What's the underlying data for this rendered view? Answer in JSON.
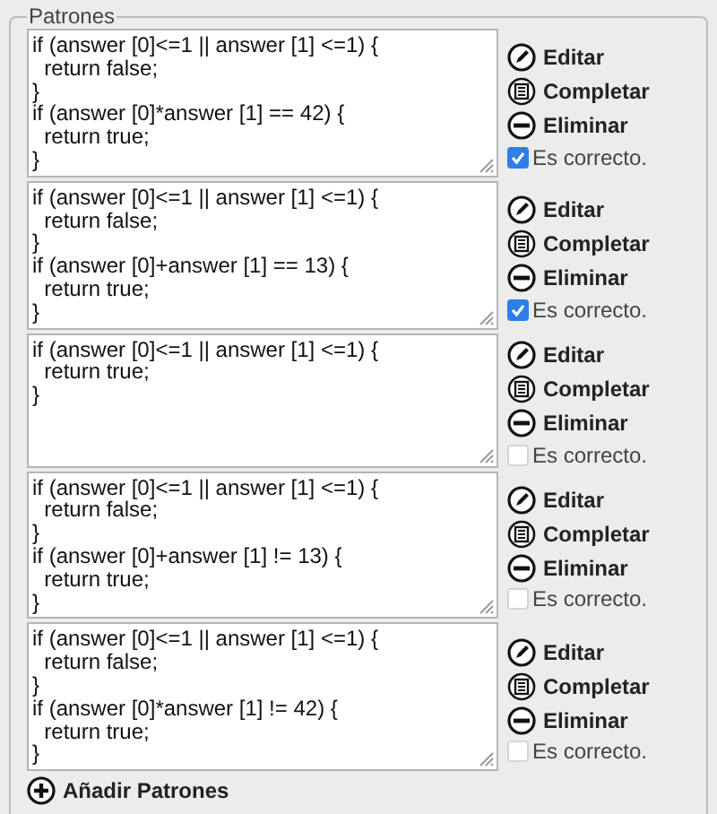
{
  "fieldset": {
    "legend": "Patrones"
  },
  "patterns": [
    {
      "code": "if (answer [0]<=1 || answer [1] <=1) {\n  return false;\n}\nif (answer [0]*answer [1] == 42) {\n  return true;\n}",
      "actions": [
        "Editar",
        "Completar",
        "Eliminar"
      ],
      "correct_label": "Es correcto.",
      "checked": true
    },
    {
      "code": "if (answer [0]<=1 || answer [1] <=1) {\n  return false;\n}\nif (answer [0]+answer [1] == 13) {\n  return true;\n}",
      "actions": [
        "Editar",
        "Completar",
        "Eliminar"
      ],
      "correct_label": "Es correcto.",
      "checked": true
    },
    {
      "code": "if (answer [0]<=1 || answer [1] <=1) {\n  return true;\n}",
      "actions": [
        "Editar",
        "Completar",
        "Eliminar"
      ],
      "correct_label": "Es correcto.",
      "checked": false
    },
    {
      "code": "if (answer [0]<=1 || answer [1] <=1) {\n  return false;\n}\nif (answer [0]+answer [1] != 13) {\n  return true;\n}",
      "actions": [
        "Editar",
        "Completar",
        "Eliminar"
      ],
      "correct_label": "Es correcto.",
      "checked": false
    },
    {
      "code": "if (answer [0]<=1 || answer [1] <=1) {\n  return false;\n}\nif (answer [0]*answer [1] != 42) {\n  return true;\n}",
      "actions": [
        "Editar",
        "Completar",
        "Eliminar"
      ],
      "correct_label": "Es correcto.",
      "checked": false
    }
  ],
  "add_button": "Añadir Patrones"
}
